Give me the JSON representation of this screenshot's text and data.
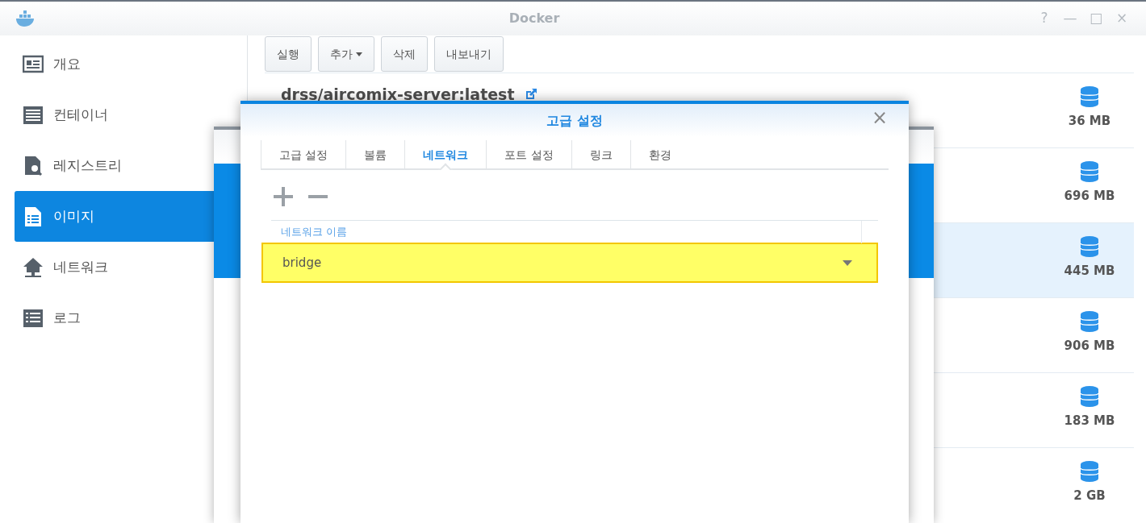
{
  "window": {
    "title": "Docker",
    "controls": [
      "?",
      "—",
      "□",
      "×"
    ]
  },
  "sidebar": {
    "items": [
      {
        "label": "개요",
        "selected": false
      },
      {
        "label": "컨테이너",
        "selected": false
      },
      {
        "label": "레지스트리",
        "selected": false
      },
      {
        "label": "이미지",
        "selected": true
      },
      {
        "label": "네트워크",
        "selected": false
      },
      {
        "label": "로그",
        "selected": false
      }
    ]
  },
  "toolbar": [
    {
      "label": "실행",
      "dropdown": false
    },
    {
      "label": "추가",
      "dropdown": true
    },
    {
      "label": "삭제",
      "dropdown": false
    },
    {
      "label": "내보내기",
      "dropdown": false
    }
  ],
  "images": [
    {
      "name": "drss/aircomix-server:latest",
      "size": "36 MB",
      "selected": false
    },
    {
      "size": "696 MB",
      "selected": false
    },
    {
      "size": "445 MB",
      "selected": true
    },
    {
      "size": "906 MB",
      "selected": false
    },
    {
      "size": "183 MB",
      "selected": false
    },
    {
      "size": "2 GB",
      "selected": false
    }
  ],
  "dialog": {
    "title": "고급 설정",
    "close": "×",
    "tabs": [
      {
        "label": "고급 설정",
        "selected": false
      },
      {
        "label": "볼륨",
        "selected": false
      },
      {
        "label": "네트워크",
        "selected": true
      },
      {
        "label": "포트 설정",
        "selected": false
      },
      {
        "label": "링크",
        "selected": false
      },
      {
        "label": "환경",
        "selected": false
      }
    ],
    "table": {
      "columns": [
        "네트워크 이름"
      ],
      "rows": [
        {
          "network_name": "bridge",
          "selected": true
        }
      ]
    }
  }
}
